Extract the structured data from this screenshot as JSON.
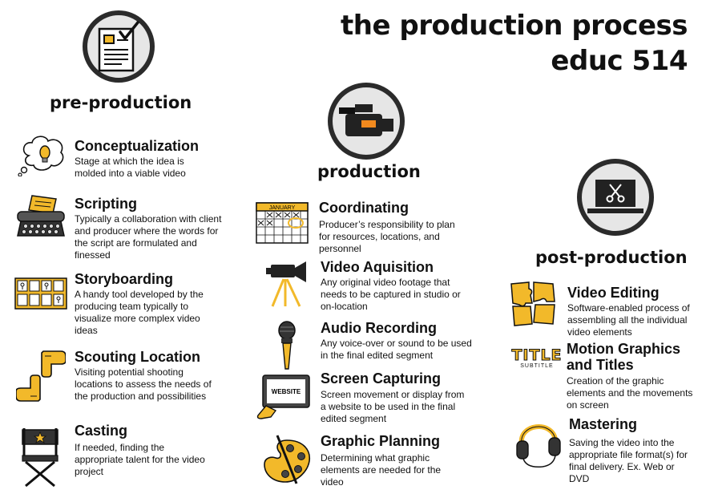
{
  "title_line1": "the production process",
  "title_line2": "educ 514",
  "phases": {
    "pre": "pre-production",
    "production": "production",
    "post": "post-production"
  },
  "pre_steps": [
    {
      "title": "Conceptualization",
      "desc": "Stage at which the idea is molded into a viable video",
      "icon": "lightbulb-thought-icon"
    },
    {
      "title": "Scripting",
      "desc": "Typically a collaboration with client and producer where the words for the script are formulated and finessed",
      "icon": "typewriter-icon"
    },
    {
      "title": "Storyboarding",
      "desc": "A handy tool developed by the producing team typically to visualize more complex video ideas",
      "icon": "storyboard-icon"
    },
    {
      "title": "Scouting Location",
      "desc": "Visiting potential shooting locations to assess the needs of the production and possibilities",
      "icon": "frame-hands-icon"
    },
    {
      "title": "Casting",
      "desc": "If needed, finding the appropriate talent for the video project",
      "icon": "director-chair-icon"
    }
  ],
  "production_steps": [
    {
      "title": "Coordinating",
      "desc": "Producer’s responsibility to plan for resources, locations, and personnel",
      "icon": "calendar-icon",
      "calendar_label": "JANUARY"
    },
    {
      "title": "Video Aquisition",
      "desc": "Any original video footage that needs to be captured in studio or on-location",
      "icon": "camera-tripod-icon"
    },
    {
      "title": "Audio Recording",
      "desc": "Any voice-over or sound to be used in the final edited segment",
      "icon": "microphone-icon"
    },
    {
      "title": "Screen Capturing",
      "desc": "Screen movement or display from a website to be used in the final edited segment",
      "icon": "website-screen-icon",
      "screen_label": "WEBSITE"
    },
    {
      "title": "Graphic Planning",
      "desc": "Determining what graphic elements are needed for the video",
      "icon": "paint-palette-icon"
    }
  ],
  "post_steps": [
    {
      "title": "Video Editing",
      "desc": "Software-enabled process of assembling all the individual video elements",
      "icon": "puzzle-icon"
    },
    {
      "title": "Motion Graphics and Titles",
      "desc": "Creation of the graphic elements and the movements on screen",
      "icon": "title-text-icon",
      "title_word": "TITLE",
      "subtitle_word": "SUBTITLE"
    },
    {
      "title": "Mastering",
      "desc": "Saving the video into the appropriate file format(s) for final delivery. Ex. Web or DVD",
      "icon": "headphones-icon"
    }
  ],
  "colors": {
    "accent_yellow": "#f2b92a",
    "ink": "#111111",
    "circle_fill": "#e6e6e6",
    "camera_orange": "#f28a1e"
  }
}
